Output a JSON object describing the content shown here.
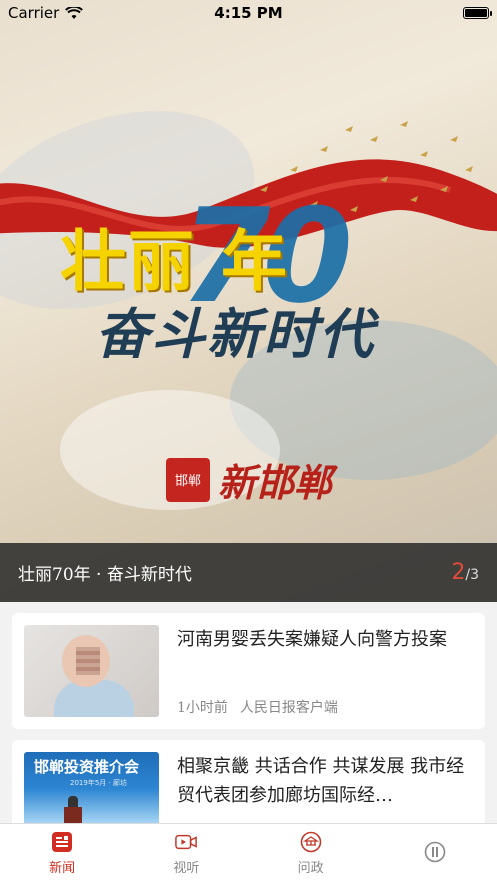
{
  "status_bar": {
    "carrier": "Carrier",
    "time": "4:15 PM",
    "battery_level": 1.0
  },
  "hero": {
    "headline_main": "壮丽  年",
    "headline_number": "70",
    "headline_sub": "奋斗新时代",
    "logo_badge": "邯郸",
    "logo_text": "新邯郸",
    "caption": "壮丽70年 · 奋斗新时代",
    "current_page": "2",
    "total_pages": "/3"
  },
  "news": [
    {
      "title": "河南男婴丢失案嫌疑人向警方投案",
      "time": "1小时前",
      "source": "人民日报客户端"
    },
    {
      "title": "相聚京畿  共话合作  共谋发展  我市经贸代表团参加廊坊国际经…",
      "thumb_title": "邯郸投资推介会",
      "thumb_sub": "2019年5月 · 廊坊",
      "time": "",
      "source": ""
    }
  ],
  "tabs": [
    {
      "label": "新闻",
      "icon": "news-icon",
      "active": true
    },
    {
      "label": "视听",
      "icon": "video-icon",
      "active": false
    },
    {
      "label": "问政",
      "icon": "government-icon",
      "active": false
    },
    {
      "label": "",
      "icon": "more-icon",
      "active": false
    }
  ],
  "colors": {
    "accent": "#d22d22",
    "caption_bg": "#282828"
  }
}
